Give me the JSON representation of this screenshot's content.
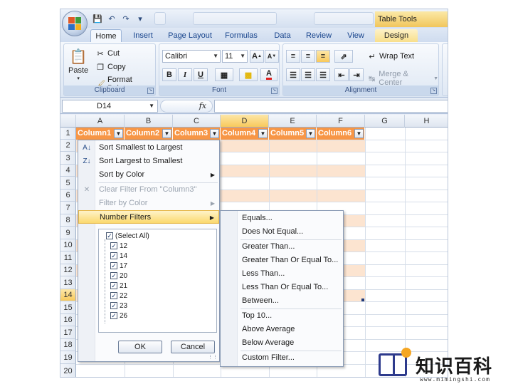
{
  "titlebar": {
    "table_tools": "Table Tools",
    "qat": [
      "save-icon",
      "undo-icon",
      "redo-icon"
    ]
  },
  "tabs": [
    "Home",
    "Insert",
    "Page Layout",
    "Formulas",
    "Data",
    "Review",
    "View",
    "Design"
  ],
  "ribbon": {
    "clipboard": {
      "paste": "Paste",
      "cut": "Cut",
      "copy": "Copy",
      "format_painter": "Format Painter",
      "label": "Clipboard"
    },
    "font": {
      "name": "Calibri",
      "size": "11",
      "bold": "B",
      "italic": "I",
      "underline": "U",
      "grow": "A",
      "shrink": "A",
      "label": "Font"
    },
    "alignment": {
      "wrap": "Wrap Text",
      "merge": "Merge & Center",
      "label": "Alignment"
    }
  },
  "formula_bar": {
    "name_box": "D14",
    "fx": "fx",
    "value": ""
  },
  "grid": {
    "columns": [
      "A",
      "B",
      "C",
      "D",
      "E",
      "F",
      "G",
      "H"
    ],
    "selected_column": "D",
    "rows": [
      "1",
      "2",
      "3",
      "4",
      "5",
      "6",
      "7",
      "8",
      "9",
      "10",
      "11",
      "12",
      "13",
      "14",
      "15",
      "16",
      "17",
      "18",
      "19",
      "20"
    ],
    "selected_row": "14",
    "headers": [
      "Column1",
      "Column2",
      "Column3",
      "Column4",
      "Column5",
      "Column6"
    ]
  },
  "filter_menu": {
    "sort_asc": "Sort Smallest to Largest",
    "sort_desc": "Sort Largest to Smallest",
    "sort_color": "Sort by Color",
    "clear_filter": "Clear Filter From \"Column3\"",
    "filter_color": "Filter by Color",
    "number_filters": "Number Filters",
    "values": [
      "(Select All)",
      "12",
      "14",
      "17",
      "20",
      "21",
      "22",
      "23",
      "26"
    ],
    "ok": "OK",
    "cancel": "Cancel"
  },
  "number_filters_submenu": [
    "Equals...",
    "Does Not Equal...",
    "Greater Than...",
    "Greater Than Or Equal To...",
    "Less Than...",
    "Less Than Or Equal To...",
    "Between...",
    "Top 10...",
    "Above Average",
    "Below Average",
    "Custom Filter..."
  ],
  "watermark": {
    "text": "知识百科",
    "url": "www.mimingshi.com"
  },
  "colors": {
    "header_orange": "#f79646",
    "band": "#fce4d0",
    "highlight": "#fbd96e"
  }
}
